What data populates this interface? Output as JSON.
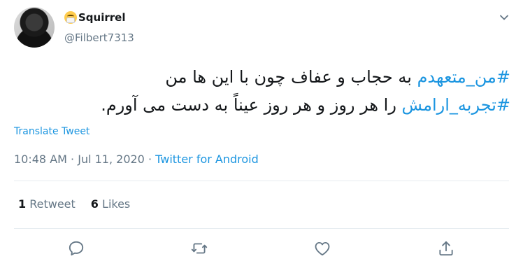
{
  "user": {
    "display_name": "Squirrel",
    "handle": "@Filbert7313",
    "name_emoji_icon": "face-with-medical-mask-icon"
  },
  "tweet": {
    "hashtag1": "#من_متعهدم",
    "line1_text": " به حجاب و عفاف چون با این ها من",
    "hashtag2": "#تجربه_ارامش",
    "line2_text": " را هر روز و هر روز عیناً به دست می آورم."
  },
  "translate_label": "Translate Tweet",
  "meta": {
    "time": "10:48 AM",
    "separator": " · ",
    "date": "Jul 11, 2020",
    "separator2": " · ",
    "source": "Twitter for Android"
  },
  "stats": {
    "retweet_count": "1",
    "retweet_label": " Retweet",
    "like_count": "6",
    "like_label": " Likes"
  },
  "actions": [
    "reply-icon",
    "retweet-icon",
    "like-icon",
    "share-icon"
  ],
  "colors": {
    "link": "#1b95e0",
    "muted": "#657786",
    "text": "#14171a",
    "divider": "#e6ecf0"
  }
}
